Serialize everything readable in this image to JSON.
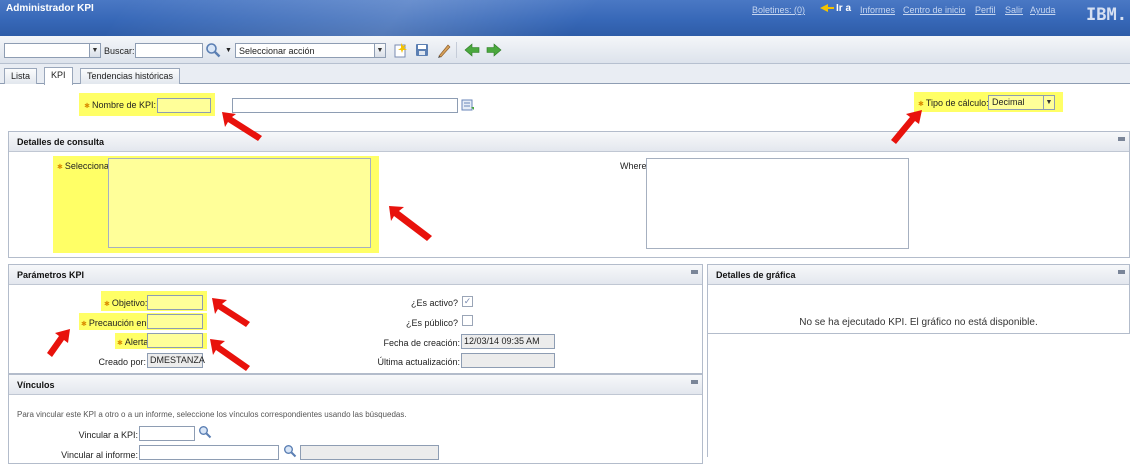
{
  "titlebar": {
    "app_title": "Administrador KPI",
    "nav": [
      "Boletines: (0)",
      "Ir a",
      "Informes",
      "Centro de inicio",
      "Perfil",
      "Salir",
      "Ayuda"
    ],
    "logo": "IBM."
  },
  "toolbar": {
    "search_label": "Buscar:",
    "search_value": "",
    "action_select": "Seleccionar acción"
  },
  "tabs": [
    "Lista",
    "KPI",
    "Tendencias históricas"
  ],
  "kpi_header": {
    "name_label": "Nombre de KPI:",
    "name_value": "",
    "description_value": "",
    "calc_type_label": "Tipo de cálculo:",
    "calc_type_value": "Decimal"
  },
  "query_section": {
    "title": "Detalles de consulta",
    "select_label": "Seleccionar:",
    "where_label": "Where:"
  },
  "params_section": {
    "title": "Parámetros KPI",
    "target_label": "Objetivo:",
    "caution_label": "Precaución en:",
    "alert_label": "Alerta en:",
    "created_by_label": "Creado por:",
    "created_by_value": "DMESTANZA",
    "active_label": "¿Es activo?",
    "public_label": "¿Es público?",
    "created_date_label": "Fecha de creación:",
    "created_date_value": "12/03/14 09:35 AM",
    "updated_label": "Última actualización:",
    "updated_value": ""
  },
  "chart_section": {
    "title": "Detalles de gráfica",
    "message": "No se ha ejecutado KPI. El gráfico no está disponible."
  },
  "links_section": {
    "title": "Vínculos",
    "help_text": "Para vincular este KPI a otro o a un informe, seleccione los vínculos correspondientes usando las búsquedas.",
    "link_kpi_label": "Vincular a KPI:",
    "link_report_label": "Vincular al informe:"
  },
  "colors": {
    "highlight": "#ffff66",
    "arrow": "#e8120c",
    "titlebar": "#3768b8"
  }
}
